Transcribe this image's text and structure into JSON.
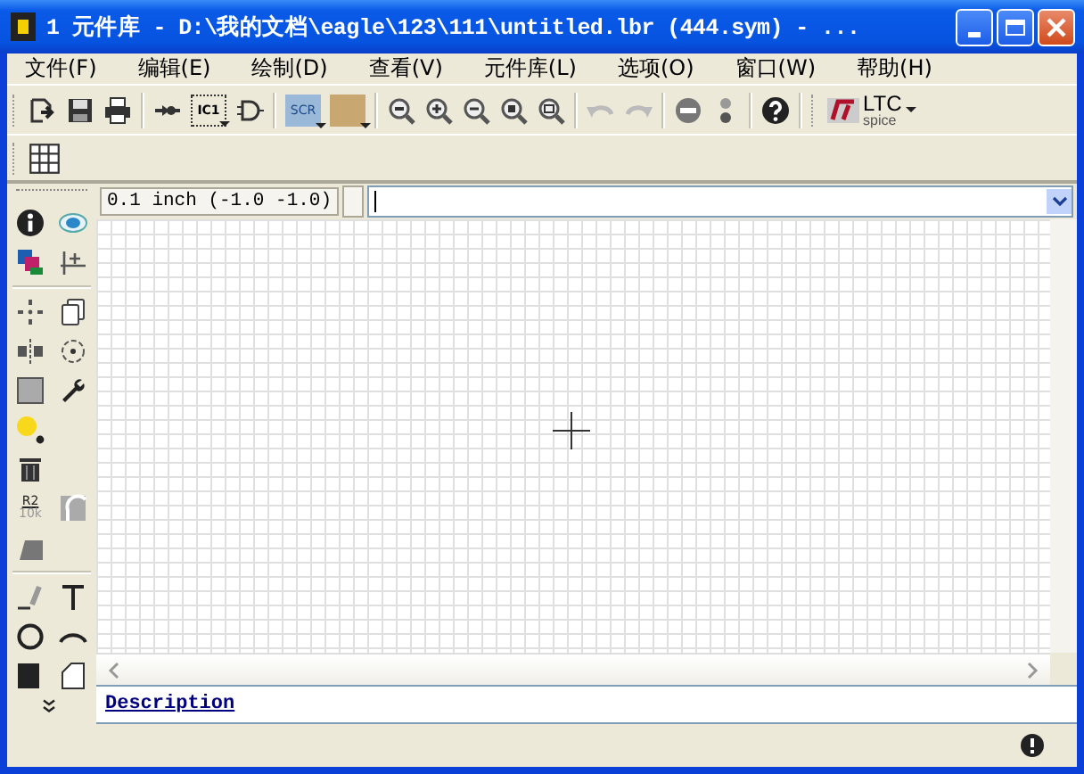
{
  "window": {
    "title": "1  元件库 - D:\\我的文档\\eagle\\123\\111\\untitled.lbr (444.sym) - ..."
  },
  "menu": [
    {
      "label": "文件(F)"
    },
    {
      "label": "编辑(E)"
    },
    {
      "label": "绘制(D)"
    },
    {
      "label": "查看(V)"
    },
    {
      "label": "元件库(L)"
    },
    {
      "label": "选项(O)"
    },
    {
      "label": "窗口(W)"
    },
    {
      "label": "帮助(H)"
    }
  ],
  "toolbar": {
    "ic_label": "IC1",
    "script_label": "SCR",
    "undo": {
      "disabled": true
    },
    "redo": {
      "disabled": true
    },
    "ltspice": {
      "label": "LTC",
      "sublabel": "spice"
    }
  },
  "command_bar": {
    "grid_readout": "0.1 inch (-1.0 -1.0)"
  },
  "left_toolbar": {
    "value_icon_top": "R2",
    "value_icon_bottom": "10k"
  },
  "description": {
    "link": "Description"
  }
}
